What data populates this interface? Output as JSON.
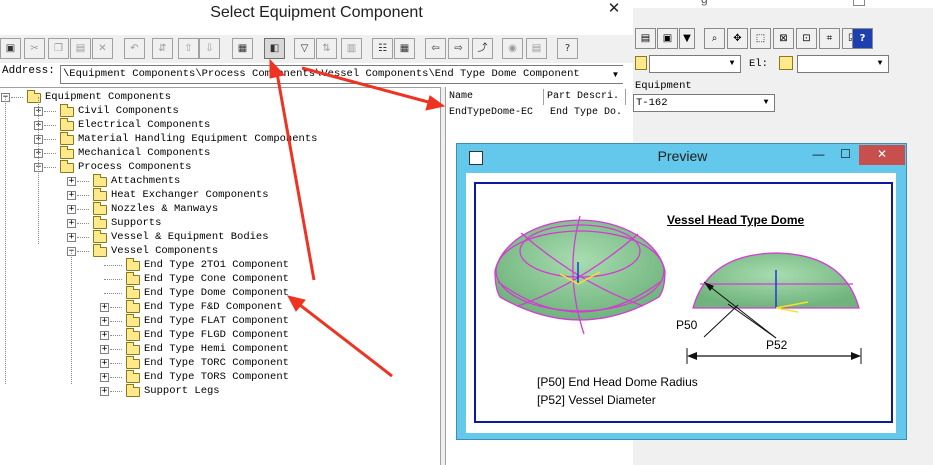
{
  "dialog": {
    "title": "Select Equipment Component",
    "close_glyph": "✕",
    "address_label": "Address:",
    "address_value": "\\Equipment Components\\Process Components\\Vessel Components\\End Type Dome Component"
  },
  "toolbar": {
    "buttons": [
      {
        "icon": "save-icon",
        "glyph": "▣"
      },
      {
        "icon": "cut-icon",
        "glyph": "✂"
      },
      {
        "icon": "copy-icon",
        "glyph": "❐"
      },
      {
        "icon": "paste-icon",
        "glyph": "▤"
      },
      {
        "icon": "delete-icon",
        "glyph": "✕"
      },
      {
        "icon": "undo-icon",
        "glyph": "↶"
      },
      {
        "icon": "move-icon",
        "glyph": "⇵"
      },
      {
        "icon": "up-icon",
        "glyph": "⇧"
      },
      {
        "icon": "down-icon",
        "glyph": "⇩"
      },
      {
        "icon": "properties-icon",
        "glyph": "▦"
      },
      {
        "icon": "preview-icon",
        "glyph": "◧"
      },
      {
        "icon": "filter-icon",
        "glyph": "▽"
      },
      {
        "icon": "sort-icon",
        "glyph": "⇅"
      },
      {
        "icon": "notes-icon",
        "glyph": "▥"
      },
      {
        "icon": "list-view-icon",
        "glyph": "☷"
      },
      {
        "icon": "details-view-icon",
        "glyph": "▦"
      },
      {
        "icon": "back-icon",
        "glyph": "⇦"
      },
      {
        "icon": "forward-icon",
        "glyph": "⇨"
      },
      {
        "icon": "parent-folder-icon",
        "glyph": "⤴"
      },
      {
        "icon": "catalog-icon",
        "glyph": "◉"
      },
      {
        "icon": "report-icon",
        "glyph": "▤"
      },
      {
        "icon": "help-icon",
        "glyph": "?"
      }
    ]
  },
  "tree": {
    "nodes": [
      {
        "label": "Equipment Components",
        "level": 0,
        "expanded": true
      },
      {
        "label": "Civil Components",
        "level": 1,
        "expanded": false
      },
      {
        "label": "Electrical Components",
        "level": 1,
        "expanded": false
      },
      {
        "label": "Material Handling Equipment Components",
        "level": 1,
        "expanded": false
      },
      {
        "label": "Mechanical Components",
        "level": 1,
        "expanded": false
      },
      {
        "label": "Process Components",
        "level": 1,
        "expanded": true
      },
      {
        "label": "Attachments",
        "level": 2,
        "expanded": false
      },
      {
        "label": "Heat Exchanger Components",
        "level": 2,
        "expanded": false
      },
      {
        "label": "Nozzles & Manways",
        "level": 2,
        "expanded": false
      },
      {
        "label": "Supports",
        "level": 2,
        "expanded": false
      },
      {
        "label": "Vessel & Equipment Bodies",
        "level": 2,
        "expanded": false
      },
      {
        "label": "Vessel Components",
        "level": 2,
        "expanded": true
      },
      {
        "label": "End Type 2TO1 Component",
        "level": 3,
        "leaf": true
      },
      {
        "label": "End Type Cone Component",
        "level": 3,
        "leaf": true
      },
      {
        "label": "End Type Dome Component",
        "level": 3,
        "leaf": true,
        "selected": true
      },
      {
        "label": "End Type F&D Component",
        "level": 3,
        "expanded": false
      },
      {
        "label": "End Type FLAT Component",
        "level": 3,
        "expanded": false
      },
      {
        "label": "End Type FLGD Component",
        "level": 3,
        "expanded": false
      },
      {
        "label": "End Type Hemi Component",
        "level": 3,
        "expanded": false
      },
      {
        "label": "End Type TORC Component",
        "level": 3,
        "expanded": false
      },
      {
        "label": "End Type TORS Component",
        "level": 3,
        "expanded": false
      },
      {
        "label": "Support Legs",
        "level": 3,
        "expanded": false
      }
    ]
  },
  "list": {
    "columns": [
      "Name",
      "Part Descri."
    ],
    "rows": [
      [
        "EndTypeDome-EC",
        "End Type Do."
      ]
    ]
  },
  "background_window": {
    "title_fragment": "g",
    "el_label": "El:",
    "equipment_label": "Equipment",
    "equipment_value": "T-162",
    "help_glyph": "?"
  },
  "preview": {
    "title": "Preview",
    "min_glyph": "—",
    "max_glyph": "☐",
    "close_glyph": "✕",
    "heading": "Vessel Head Type Dome",
    "label_p50": "P50",
    "label_p52": "P52",
    "caption_1": "[P50] End Head Dome Radius",
    "caption_2": "[P52] Vessel Diameter",
    "colors": {
      "dome_fill": "#7fc48a",
      "wire": "#d23cd2",
      "axis_yellow": "#f2e52a",
      "axis_blue": "#1b3cd8",
      "frame": "#0a1aa0"
    }
  },
  "annotations": {
    "arrow_color": "#ee3322"
  }
}
